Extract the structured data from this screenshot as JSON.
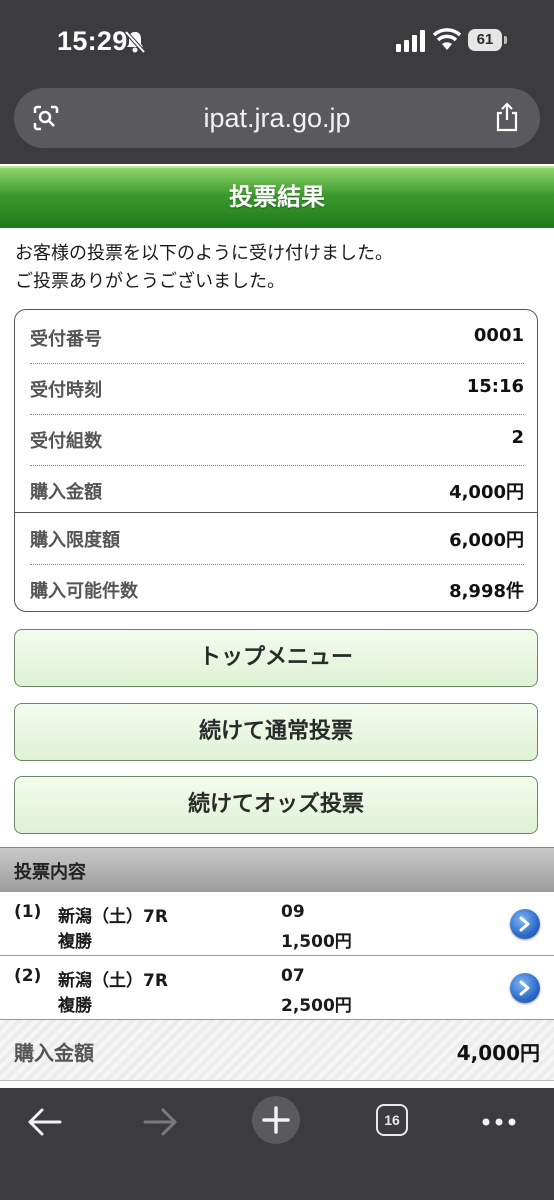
{
  "status_bar": {
    "time": "15:29",
    "battery": "61"
  },
  "browser": {
    "url": "ipat.jra.go.jp",
    "tab_count": "16"
  },
  "page": {
    "title": "投票結果",
    "intro_line1": "お客様の投票を以下のように受け付けました。",
    "intro_line2": "ご投票ありがとうございました。"
  },
  "summary": [
    {
      "label": "受付番号",
      "value": "0001"
    },
    {
      "label": "受付時刻",
      "value": "15:16"
    },
    {
      "label": "受付組数",
      "value": "2"
    },
    {
      "label": "購入金額",
      "value": "4,000円"
    },
    {
      "label": "購入限度額",
      "value": "6,000円"
    },
    {
      "label": "購入可能件数",
      "value": "8,998件"
    }
  ],
  "buttons": {
    "top_menu": "トップメニュー",
    "continue_normal": "続けて通常投票",
    "continue_odds": "続けてオッズ投票"
  },
  "bets_header": "投票内容",
  "bets": [
    {
      "num": "(1)",
      "race": "新潟（土）7R",
      "type": "複勝",
      "horse": "09",
      "amount": "1,500円"
    },
    {
      "num": "(2)",
      "race": "新潟（土）7R",
      "type": "複勝",
      "horse": "07",
      "amount": "2,500円"
    }
  ],
  "total": {
    "label": "購入金額",
    "value": "4,000円"
  },
  "icons": [
    "bell-slash-icon",
    "signal-icon",
    "wifi-icon",
    "battery-icon",
    "lens-icon",
    "share-icon",
    "chevron-right-icon",
    "back-icon",
    "forward-icon",
    "plus-icon",
    "tabs-icon",
    "more-icon"
  ],
  "colors": {
    "title_green": "#1e7a1a",
    "button_green": "#dff2d4",
    "chevron_blue": "#2c6ac8"
  }
}
